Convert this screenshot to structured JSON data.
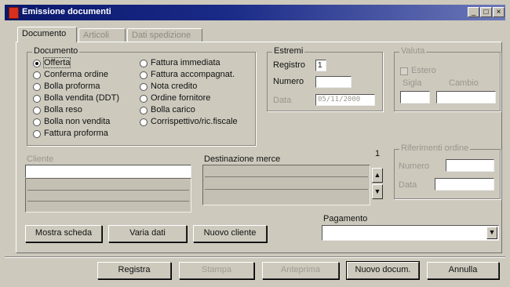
{
  "window": {
    "title": "Emissione documenti",
    "controls": {
      "minimize": "_",
      "maximize": "□",
      "close": "×"
    }
  },
  "tabs": [
    "Documento",
    "Articoli",
    "Dati spedizione"
  ],
  "documento_group": {
    "label": "Documento",
    "options_left": [
      "Offerta",
      "Conferma ordine",
      "Bolla proforma",
      "Bolla vendita (DDT)",
      "Bolla reso",
      "Bolla non vendita",
      "Fattura proforma"
    ],
    "options_right": [
      "Fattura immediata",
      "Fattura accompagnat.",
      "Nota credito",
      "Ordine fornitore",
      "Bolla carico",
      "Corrispettivo/ric.fiscale"
    ],
    "selected": "Offerta"
  },
  "estremi": {
    "label": "Estremi",
    "registro_label": "Registro",
    "registro_value": "1",
    "numero_label": "Numero",
    "numero_value": "",
    "data_label": "Data",
    "data_value": "05/11/2000"
  },
  "valuta": {
    "label": "Valuta",
    "estero_label": "Estero",
    "sigla_label": "Sigla",
    "cambio_label": "Cambio"
  },
  "cliente": {
    "label": "Cliente"
  },
  "destinazione": {
    "label": "Destinazione merce",
    "counter": "1"
  },
  "riferimenti": {
    "label": "Riferimenti ordine",
    "numero_label": "Numero",
    "data_label": "Data"
  },
  "pagamento": {
    "label": "Pagamento",
    "value": ""
  },
  "client_buttons": {
    "mostra": "Mostra scheda",
    "varia": "Varia dati",
    "nuovo": "Nuovo cliente"
  },
  "bottom_buttons": {
    "registra": "Registra",
    "stampa": "Stampa",
    "anteprima": "Anteprima",
    "nuovo_docum": "Nuovo docum.",
    "annulla": "Annulla"
  }
}
